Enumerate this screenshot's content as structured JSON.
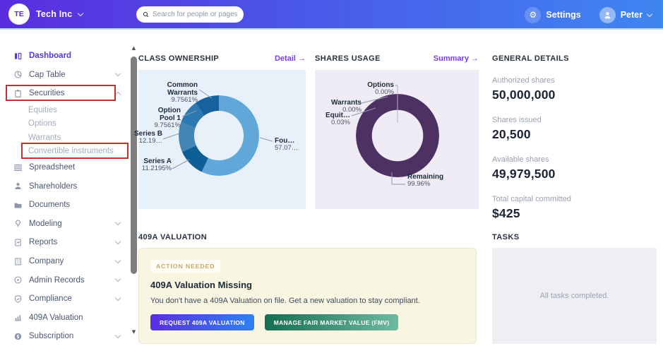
{
  "topbar": {
    "company_initials": "TE",
    "company_name": "Tech Inc",
    "search_placeholder": "Search for people or pages",
    "settings_label": "Settings",
    "user_name": "Peter"
  },
  "icons": {
    "gear": "⚙",
    "up_arrow": "▲",
    "down_arrow": "▼"
  },
  "sidebar": {
    "items": [
      {
        "label": "Dashboard",
        "active": true
      },
      {
        "label": "Cap Table",
        "chevron": "down"
      },
      {
        "label": "Securities",
        "chevron": "up",
        "boxed": true
      },
      {
        "label": "Equities",
        "sub": true
      },
      {
        "label": "Options",
        "sub": true
      },
      {
        "label": "Warrants",
        "sub": true
      },
      {
        "label": "Convertible instruments",
        "sub": true,
        "boxed": true
      },
      {
        "label": "Spreadsheet"
      },
      {
        "label": "Shareholders"
      },
      {
        "label": "Documents"
      },
      {
        "label": "Modeling",
        "chevron": "down"
      },
      {
        "label": "Reports",
        "chevron": "down"
      },
      {
        "label": "Company",
        "chevron": "down"
      },
      {
        "label": "Admin Records",
        "chevron": "down"
      },
      {
        "label": "Compliance",
        "chevron": "down"
      },
      {
        "label": "409A Valuation"
      },
      {
        "label": "Subscription",
        "chevron": "down"
      }
    ]
  },
  "main": {
    "class_ownership": {
      "title": "CLASS OWNERSHIP",
      "link": "Detail →"
    },
    "shares_usage": {
      "title": "SHARES USAGE",
      "link": "Summary →"
    },
    "general_details": {
      "title": "GENERAL DETAILS",
      "stats": [
        {
          "label": "Authorized shares",
          "value": "50,000,000"
        },
        {
          "label": "Shares issued",
          "value": "20,500"
        },
        {
          "label": "Available shares",
          "value": "49,979,500"
        },
        {
          "label": "Total capital committed",
          "value": "$425"
        }
      ]
    },
    "valuation_409a": {
      "title": "409A VALUATION",
      "badge": "ACTION NEEDED",
      "heading": "409A Valuation Missing",
      "body": "You don't have a 409A Valuation on file. Get a new valuation to stay compliant.",
      "request_button": "REQUEST 409A VALUATION",
      "manage_button": "MANAGE FAIR MARKET VALUE (FMV)"
    },
    "tasks": {
      "title": "TASKS",
      "empty_message": "All tasks completed."
    }
  },
  "colors": {
    "navbar_gradient": [
      "#5b2cdf",
      "#3f86f2"
    ],
    "annotation_red": "#c5322d",
    "link_purple": "#7c3ced",
    "active_purple": "#5736d6"
  },
  "chart_data": [
    {
      "type": "pie",
      "title": "CLASS OWNERSHIP",
      "legend_position": "callout-labels",
      "slices": [
        {
          "label": "Founders",
          "display_label": "Fou…",
          "value": 57.07,
          "display_value": "57.07…",
          "color": "#61a7d9"
        },
        {
          "label": "Series A",
          "display_label": "Series A",
          "value": 11.2195,
          "display_value": "11.2195%",
          "color": "#0d6097"
        },
        {
          "label": "Series B",
          "display_label": "Series B",
          "value": 12.19,
          "display_value": "12.19…",
          "color": "#4286b8"
        },
        {
          "label": "Option Pool 1",
          "display_label": "Option Pool 1",
          "value": 9.7561,
          "display_value": "9.7561%",
          "color": "#2b79ae"
        },
        {
          "label": "Common Warrants",
          "display_label": "Common Warrants",
          "value": 9.7561,
          "display_value": "9.7561%",
          "color": "#15629f"
        }
      ]
    },
    {
      "type": "pie",
      "title": "SHARES USAGE",
      "legend_position": "callout-labels",
      "slices": [
        {
          "label": "Options",
          "display_label": "Options",
          "value": 0.0,
          "display_value": "0.00%",
          "color": "#4e3163"
        },
        {
          "label": "Warrants",
          "display_label": "Warrants",
          "value": 0.0,
          "display_value": "0.00%",
          "color": "#4e3163"
        },
        {
          "label": "Equity",
          "display_label": "Equit…",
          "value": 0.03,
          "display_value": "0.03%",
          "color": "#4e3163"
        },
        {
          "label": "Remaining",
          "display_label": "Remaining",
          "value": 99.96,
          "display_value": "99.96%",
          "color": "#4e3163"
        }
      ]
    }
  ]
}
